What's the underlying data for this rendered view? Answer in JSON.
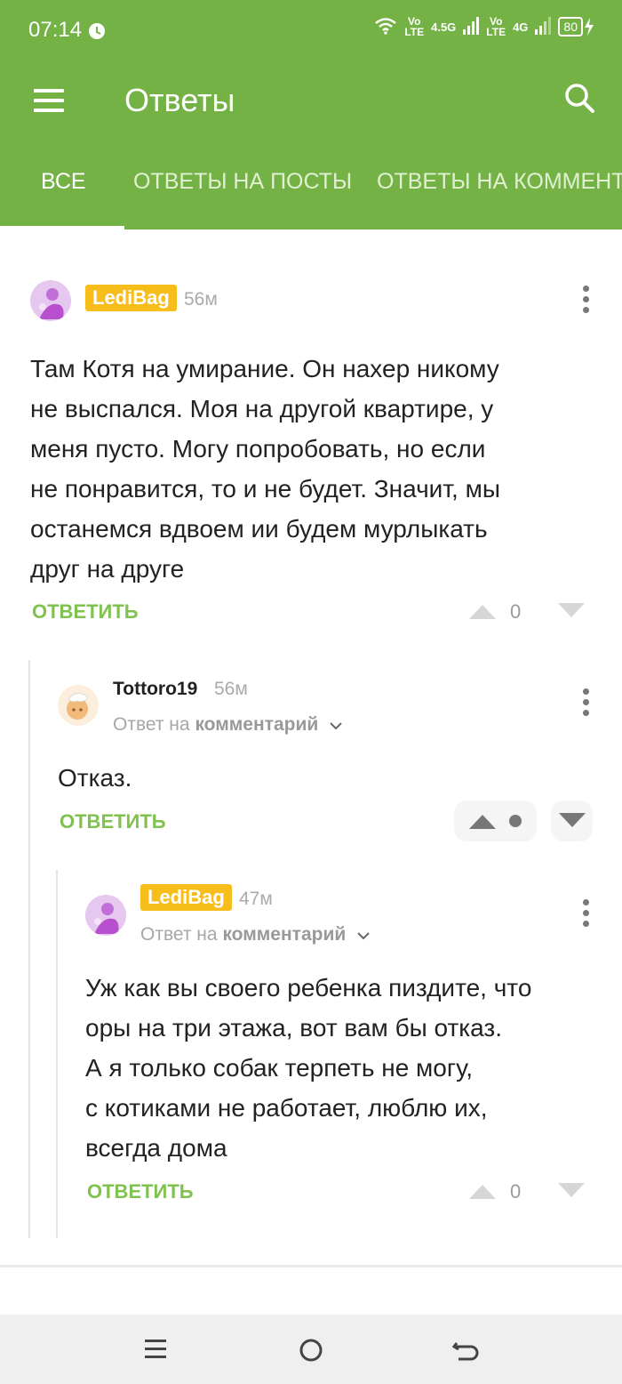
{
  "status": {
    "time": "07:14",
    "net1": "4.5G",
    "net2": "4G",
    "volte1_top": "Vo",
    "volte1_bottom": "LTE",
    "volte2_top": "Vo",
    "volte2_bottom": "LTE",
    "battery": "80"
  },
  "toolbar": {
    "title": "Ответы"
  },
  "tabs": [
    {
      "label": "ВСЕ"
    },
    {
      "label": "ОТВЕТЫ НА ПОСТЫ"
    },
    {
      "label": "ОТВЕТЫ НА КОММЕНТАРИИ"
    }
  ],
  "colors": {
    "brand": "#74b245",
    "badge": "#f7bd1b",
    "reply": "#80c24f"
  },
  "comments": [
    {
      "author": "LediBag",
      "time": "56м",
      "text_lines": [
        "Там Котя на умирание. Он нахер никому",
        "не выспался. Моя на другой квартире, у",
        "меня пусто. Могу попробовать, но если",
        "не понравится, то и не будет. Значит, мы",
        "останемся вдвоем ии будем мурлыкать",
        "друг на друге"
      ],
      "reply_label": "ОТВЕТИТЬ",
      "score": "0"
    },
    {
      "author": "Tottoro19",
      "time": "56м",
      "reply_prefix": "Ответ на",
      "reply_target": "комментарий",
      "text": "Отказ.",
      "reply_label": "ОТВЕТИТЬ"
    },
    {
      "author": "LediBag",
      "time": "47м",
      "reply_prefix": "Ответ на",
      "reply_target": "комментарий",
      "text_lines": [
        "Уж как вы своего ребенка пиздите, что",
        "оры на три этажа, вот вам бы отказ.",
        "А я только собак терпеть не могу,",
        "с котиками не работает, люблю их,",
        "всегда дома"
      ],
      "reply_label": "ОТВЕТИТЬ",
      "score": "0"
    }
  ]
}
